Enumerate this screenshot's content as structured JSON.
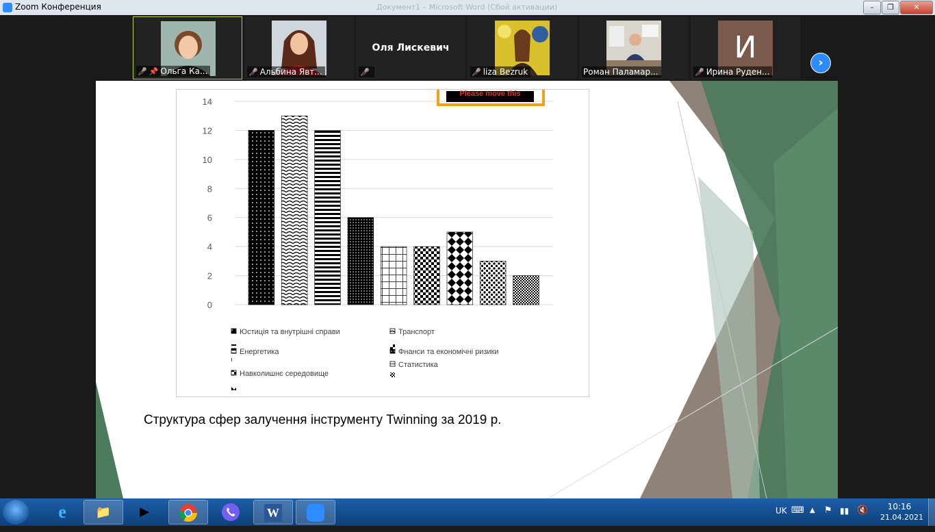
{
  "window": {
    "title": "Zoom Конференция",
    "ghost_title": "Документ1 – Microsoft Word (Сбой активации)"
  },
  "participants": [
    {
      "name": "Ольга Ка...",
      "muted": true,
      "pinned": true,
      "active": true,
      "photo": "photo-1"
    },
    {
      "name": "Альбина Явт...",
      "muted": true,
      "photo": "photo-2"
    },
    {
      "name": "",
      "muted": true,
      "display_name": "Оля Лискевич"
    },
    {
      "name": "liza Bezruk",
      "muted": true,
      "photo": "photo-3"
    },
    {
      "name": "Роман Паламар...",
      "muted": false,
      "photo": "photo-4"
    },
    {
      "name": "Ирина Руден...",
      "muted": true,
      "initial": "И"
    }
  ],
  "overlay_text": "Please move this",
  "chart_data": {
    "type": "bar",
    "ylim": [
      0,
      14
    ],
    "yticks": [
      0,
      2,
      4,
      6,
      8,
      10,
      12,
      14
    ],
    "values": [
      12,
      13,
      12,
      6,
      4,
      4,
      5,
      3,
      2
    ],
    "patterns": [
      "dots-dark",
      "scales",
      "hlines",
      "dense-dots",
      "grid",
      "checker",
      "diamonds",
      "sparse-dots",
      "fine-checker"
    ],
    "legend": [
      "Юстиція та внутрішні справи",
      "Транспорт",
      "Енергетика",
      "Фнанси та економічні ризики",
      "Статистика",
      "Навколишнє середовище"
    ]
  },
  "slide": {
    "caption": "Структура сфер залучення інструменту Twinning за 2019 р."
  },
  "taskbar": {
    "lang": "UK",
    "time": "10:16",
    "date": "21.04.2021",
    "apps": [
      "explorer",
      "media-player",
      "chrome",
      "viber",
      "word",
      "zoom"
    ]
  }
}
